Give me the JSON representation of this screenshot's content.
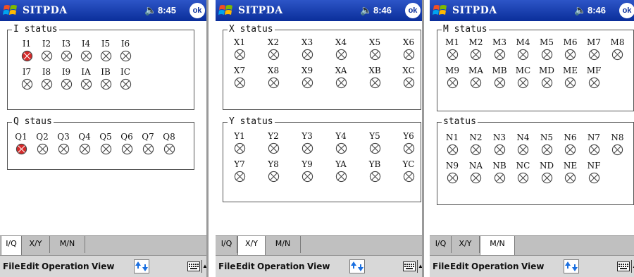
{
  "app": {
    "title": "SITPDA",
    "ok_label": "ok"
  },
  "colors": {
    "title_bar": "#1b3fb0",
    "led_on": "#d52a2a",
    "led_off": "#ffffff"
  },
  "menu": [
    "File",
    "Edit",
    "Operation",
    "View"
  ],
  "tabs": [
    "I/Q",
    "X/Y",
    "M/N"
  ],
  "screens": [
    {
      "time": "8:45",
      "active_tab": 0,
      "groups": [
        {
          "title": "I status",
          "items": [
            {
              "label": "I1",
              "on": true
            },
            {
              "label": "I2",
              "on": false
            },
            {
              "label": "I3",
              "on": false
            },
            {
              "label": "I4",
              "on": false
            },
            {
              "label": "I5",
              "on": false
            },
            {
              "label": "I6",
              "on": false
            },
            {
              "label": "I7",
              "on": false
            },
            {
              "label": "I8",
              "on": false
            },
            {
              "label": "I9",
              "on": false
            },
            {
              "label": "IA",
              "on": false
            },
            {
              "label": "IB",
              "on": false
            },
            {
              "label": "IC",
              "on": false
            }
          ]
        },
        {
          "title": "Q staus",
          "items": [
            {
              "label": "Q1",
              "on": true
            },
            {
              "label": "Q2",
              "on": false
            },
            {
              "label": "Q3",
              "on": false
            },
            {
              "label": "Q4",
              "on": false
            },
            {
              "label": "Q5",
              "on": false
            },
            {
              "label": "Q6",
              "on": false
            },
            {
              "label": "Q7",
              "on": false
            },
            {
              "label": "Q8",
              "on": false
            }
          ]
        }
      ]
    },
    {
      "time": "8:46",
      "active_tab": 1,
      "groups": [
        {
          "title": "X status",
          "items": [
            {
              "label": "X1",
              "on": false
            },
            {
              "label": "X2",
              "on": false
            },
            {
              "label": "X3",
              "on": false
            },
            {
              "label": "X4",
              "on": false
            },
            {
              "label": "X5",
              "on": false
            },
            {
              "label": "X6",
              "on": false
            },
            {
              "label": "X7",
              "on": false
            },
            {
              "label": "X8",
              "on": false
            },
            {
              "label": "X9",
              "on": false
            },
            {
              "label": "XA",
              "on": false
            },
            {
              "label": "XB",
              "on": false
            },
            {
              "label": "XC",
              "on": false
            }
          ]
        },
        {
          "title": "Y status",
          "items": [
            {
              "label": "Y1",
              "on": false
            },
            {
              "label": "Y2",
              "on": false
            },
            {
              "label": "Y3",
              "on": false
            },
            {
              "label": "Y4",
              "on": false
            },
            {
              "label": "Y5",
              "on": false
            },
            {
              "label": "Y6",
              "on": false
            },
            {
              "label": "Y7",
              "on": false
            },
            {
              "label": "Y8",
              "on": false
            },
            {
              "label": "Y9",
              "on": false
            },
            {
              "label": "YA",
              "on": false
            },
            {
              "label": "YB",
              "on": false
            },
            {
              "label": "YC",
              "on": false
            }
          ]
        }
      ]
    },
    {
      "time": "8:46",
      "active_tab": 2,
      "groups": [
        {
          "title": "M status",
          "items": [
            {
              "label": "M1",
              "on": false
            },
            {
              "label": "M2",
              "on": false
            },
            {
              "label": "M3",
              "on": false
            },
            {
              "label": "M4",
              "on": false
            },
            {
              "label": "M5",
              "on": false
            },
            {
              "label": "M6",
              "on": false
            },
            {
              "label": "M7",
              "on": false
            },
            {
              "label": "M8",
              "on": false
            },
            {
              "label": "M9",
              "on": false
            },
            {
              "label": "MA",
              "on": false
            },
            {
              "label": "MB",
              "on": false
            },
            {
              "label": "MC",
              "on": false
            },
            {
              "label": "MD",
              "on": false
            },
            {
              "label": "ME",
              "on": false
            },
            {
              "label": "MF",
              "on": false
            }
          ]
        },
        {
          "title": "status",
          "items": [
            {
              "label": "N1",
              "on": false
            },
            {
              "label": "N2",
              "on": false
            },
            {
              "label": "N3",
              "on": false
            },
            {
              "label": "N4",
              "on": false
            },
            {
              "label": "N5",
              "on": false
            },
            {
              "label": "N6",
              "on": false
            },
            {
              "label": "N7",
              "on": false
            },
            {
              "label": "N8",
              "on": false
            },
            {
              "label": "N9",
              "on": false
            },
            {
              "label": "NA",
              "on": false
            },
            {
              "label": "NB",
              "on": false
            },
            {
              "label": "NC",
              "on": false
            },
            {
              "label": "ND",
              "on": false
            },
            {
              "label": "NE",
              "on": false
            },
            {
              "label": "NF",
              "on": false
            }
          ]
        }
      ]
    }
  ]
}
